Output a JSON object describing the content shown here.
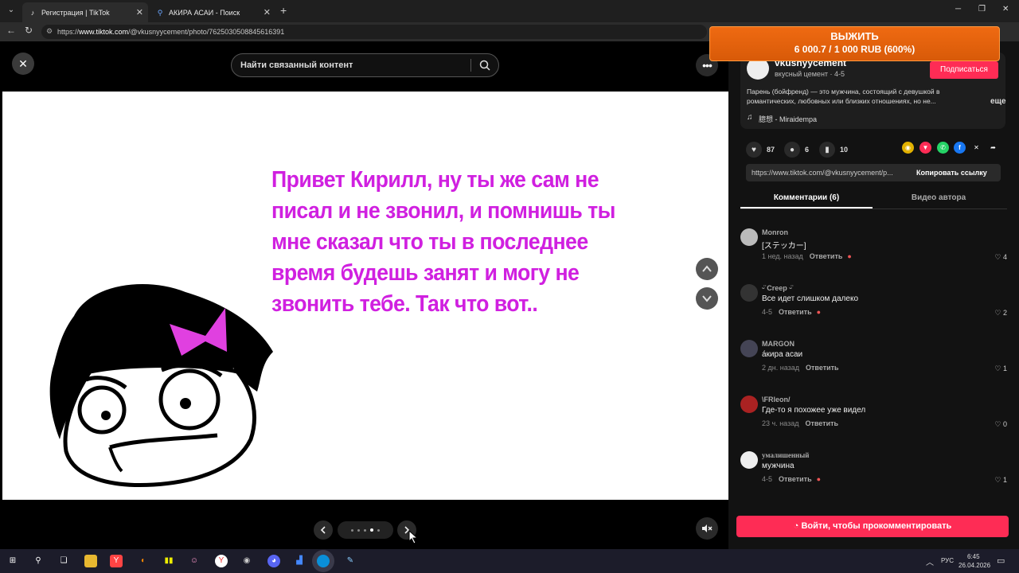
{
  "browser": {
    "tabs": [
      {
        "label": "Регистрация | TikTok",
        "active": true
      },
      {
        "label": "АКИРА АСАИ - Поиск",
        "active": false
      }
    ],
    "url_prefix": "https://",
    "url_host": "www.tiktok.com",
    "url_path": "/@vkusnyycement/photo/7625030508845616391"
  },
  "viewer": {
    "search_placeholder": "Найти связанный контент",
    "caption_image_text": "Привет Кирилл, ну ты же сам не писал и не звонил, и помнишь ты мне сказал что ты в последнее время будешь занят и могу не звонить тебе. Так что вот..",
    "carousel_dots": 5,
    "active_dot": 4
  },
  "price_banner": {
    "title": "ВЫЖИТЬ",
    "value": "6 000.7 / 1 000 RUB (600%)"
  },
  "author": {
    "username": "vkusnyycement",
    "nickname_date": "вкусный цемент · 4-5",
    "follow_label": "Подписаться",
    "description": "Парень (бойфренд) — это мужчина, состоящий с девушкой в романтических, любовных или близких отношениях, но не...",
    "more_label": "еще",
    "music": "臆想 - Miraidempa"
  },
  "metrics": {
    "likes": "87",
    "comments": "6",
    "saves": "10"
  },
  "share_link": {
    "url": "https://www.tiktok.com/@vkusnyycement/p...",
    "copy_label": "Копировать ссылку"
  },
  "tabs": {
    "comments": "Комментарии (6)",
    "creator_videos": "Видео автора"
  },
  "reply_label": "Ответить",
  "comments": [
    {
      "author": "Monron",
      "text": "[ステッカー]",
      "time": "1 нед. назад",
      "likes": "4"
    },
    {
      "author": "ᵕ̈ Creep ᵕ̈",
      "text": "Все идет слишком далеко",
      "time": "4-5",
      "likes": "2"
    },
    {
      "author": "MARGON",
      "text": "а́кира асаи",
      "time": "2 дн. назад",
      "likes": "1"
    },
    {
      "author": "\\FRleon/",
      "text": "Где-то я похожее уже видел",
      "time": "23 ч. назад",
      "likes": "0"
    },
    {
      "author": "умалишенный",
      "text": "мужчина",
      "time": "4-5",
      "likes": "1"
    }
  ],
  "login_comment_label": "Войти, чтобы прокомментировать",
  "taskbar": {
    "lang": "РУС",
    "time": "6:45",
    "date": "26.04.2026"
  },
  "colors": {
    "accent": "#fe2c55",
    "caption": "#d020e0",
    "banner": "#e8650f"
  }
}
